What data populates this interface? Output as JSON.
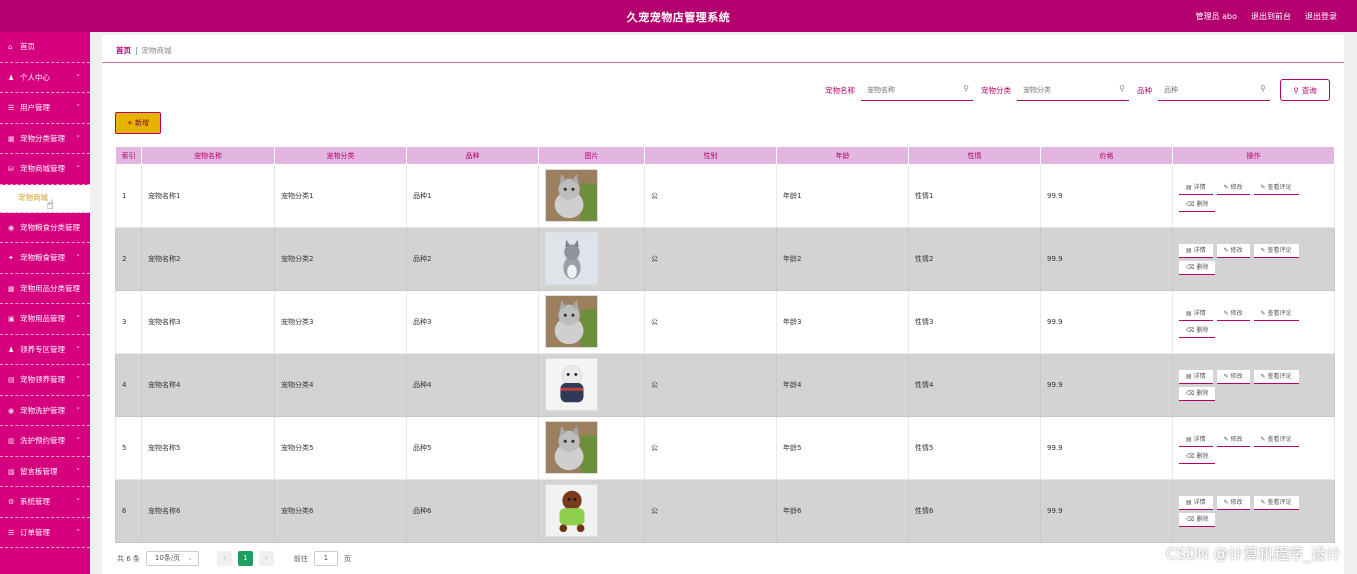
{
  "header": {
    "title": "久宠宠物店管理系统",
    "admin_label": "管理员 abo",
    "to_front": "退出到前台",
    "logout": "退出登录"
  },
  "sidebar": {
    "items": [
      {
        "label": "首页",
        "icon": "home-icon",
        "has_arrow": false
      },
      {
        "label": "个人中心",
        "icon": "user-icon",
        "has_arrow": true
      },
      {
        "label": "用户管理",
        "icon": "list-icon",
        "has_arrow": true
      },
      {
        "label": "宠物分类管理",
        "icon": "grid-icon",
        "has_arrow": true
      },
      {
        "label": "宠物商城管理",
        "icon": "shop-icon",
        "has_arrow": true,
        "expanded": true
      },
      {
        "label": "宠物商城",
        "sub": true
      },
      {
        "label": "宠物粮食分类管理",
        "icon": "pin-icon",
        "has_arrow": false
      },
      {
        "label": "宠物粮食管理",
        "icon": "star-icon",
        "has_arrow": true
      },
      {
        "label": "宠物用品分类管理",
        "icon": "grid-icon",
        "has_arrow": false
      },
      {
        "label": "宠物用品管理",
        "icon": "apps-icon",
        "has_arrow": true
      },
      {
        "label": "领养专区管理",
        "icon": "user-icon",
        "has_arrow": true
      },
      {
        "label": "宠物领养管理",
        "icon": "doc-icon",
        "has_arrow": true
      },
      {
        "label": "宠物洗护管理",
        "icon": "pin-icon",
        "has_arrow": true
      },
      {
        "label": "洗护预约管理",
        "icon": "calendar-icon",
        "has_arrow": true
      },
      {
        "label": "留言板管理",
        "icon": "chart-icon",
        "has_arrow": true
      },
      {
        "label": "系统管理",
        "icon": "gear-icon",
        "has_arrow": true
      },
      {
        "label": "订单管理",
        "icon": "list-icon",
        "has_arrow": true
      }
    ]
  },
  "breadcrumb": {
    "home": "首页",
    "separator": "|",
    "current": "宠物商城"
  },
  "search": {
    "name_label": "宠物名称",
    "name_placeholder": "宠物名称",
    "category_label": "宠物分类",
    "category_placeholder": "宠物分类",
    "breed_label": "品种",
    "breed_placeholder": "品种",
    "query_button": "查询"
  },
  "add_button": "+ 新增",
  "table": {
    "headers": [
      "索引",
      "宠物名称",
      "宠物分类",
      "品种",
      "图片",
      "性别",
      "年龄",
      "性情",
      "价格",
      "操作"
    ],
    "rows": [
      {
        "index": "1",
        "name": "宠物名称1",
        "category": "宠物分类1",
        "breed": "品种1",
        "image": "gray-cat",
        "gender": "公",
        "age": "年龄1",
        "temper": "性情1",
        "price": "99.9"
      },
      {
        "index": "2",
        "name": "宠物名称2",
        "category": "宠物分类2",
        "breed": "品种2",
        "image": "gray-kitten",
        "gender": "公",
        "age": "年龄2",
        "temper": "性情2",
        "price": "99.9"
      },
      {
        "index": "3",
        "name": "宠物名称3",
        "category": "宠物分类3",
        "breed": "品种3",
        "image": "gray-cat",
        "gender": "公",
        "age": "年龄3",
        "temper": "性情3",
        "price": "99.9"
      },
      {
        "index": "4",
        "name": "宠物名称4",
        "category": "宠物分类4",
        "breed": "品种4",
        "image": "white-dog",
        "gender": "公",
        "age": "年龄4",
        "temper": "性情4",
        "price": "99.9"
      },
      {
        "index": "5",
        "name": "宠物名称5",
        "category": "宠物分类5",
        "breed": "品种5",
        "image": "gray-cat",
        "gender": "公",
        "age": "年龄5",
        "temper": "性情5",
        "price": "99.9"
      },
      {
        "index": "6",
        "name": "宠物名称6",
        "category": "宠物分类6",
        "breed": "品种6",
        "image": "brown-poodle",
        "gender": "公",
        "age": "年龄6",
        "temper": "性情6",
        "price": "99.9"
      }
    ],
    "actions": {
      "detail": "详情",
      "edit": "修改",
      "reviews": "查看评论",
      "delete": "删除"
    }
  },
  "pager": {
    "total": "共 6 条",
    "page_size": "10条/页",
    "prev": "‹",
    "current": "1",
    "next": "›",
    "goto_label": "前往",
    "goto_value": "1",
    "page_suffix": "页"
  },
  "watermark": "CSDN @计算机程序_设计",
  "colors": {
    "header": "#b3006e",
    "sidebar": "#d6007f",
    "table_header": "#e3b6e1",
    "accent": "#b3006e",
    "add_button": "#e6b400",
    "pager_active": "#1e9e5f"
  }
}
